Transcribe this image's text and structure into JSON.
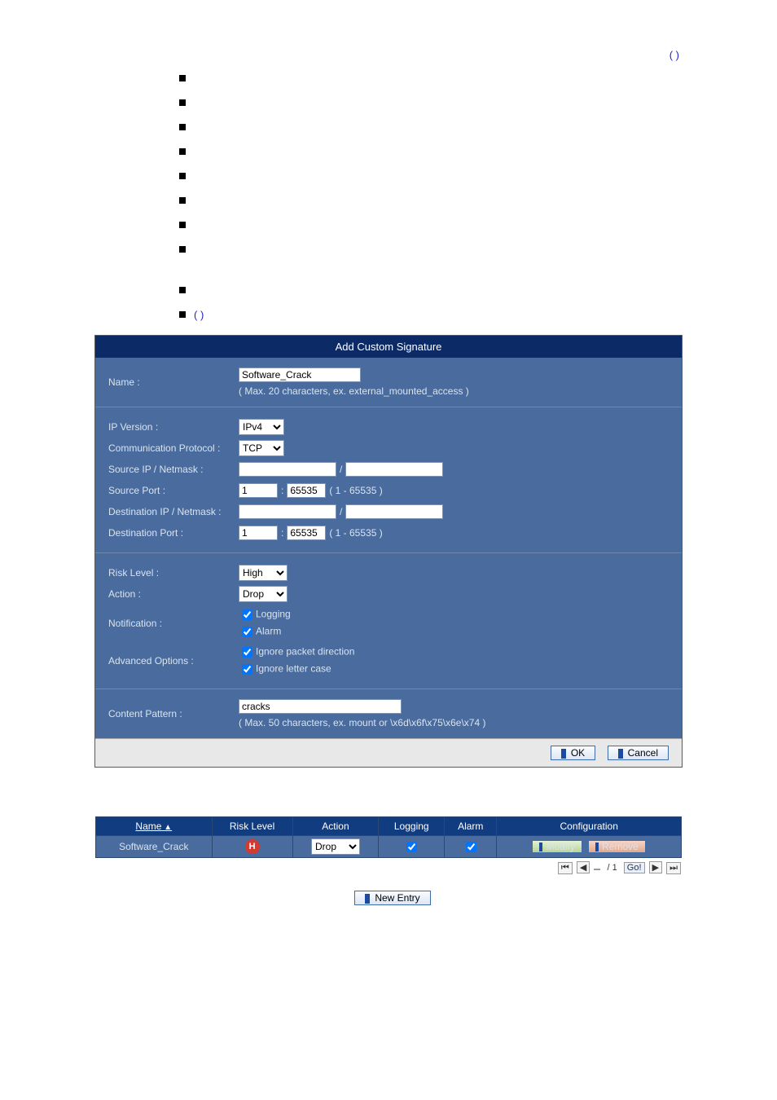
{
  "header": {
    "paren": "(          )",
    "listParen": "(             )"
  },
  "form": {
    "title": "Add Custom Signature",
    "labels": {
      "name": "Name :",
      "ipversion": "IP Version :",
      "protocol": "Communication Protocol :",
      "srcip": "Source IP / Netmask :",
      "srcport": "Source Port :",
      "dstip": "Destination IP / Netmask :",
      "dstport": "Destination Port :",
      "risk": "Risk Level :",
      "action": "Action :",
      "notification": "Notification :",
      "advanced": "Advanced Options :",
      "content": "Content Pattern :"
    },
    "values": {
      "name": "Software_Crack",
      "ipversion": "IPv4",
      "protocol": "TCP",
      "srcPortFrom": "1",
      "srcPortTo": "65535",
      "dstPortFrom": "1",
      "dstPortTo": "65535",
      "risk": "High",
      "action": "Drop",
      "content": "cracks"
    },
    "hints": {
      "name": "( Max. 20 characters, ex. external_mounted_access )",
      "port": "( 1 - 65535 )",
      "content": "( Max. 50 characters, ex. mount or \\x6d\\x6f\\x75\\x6e\\x74 )"
    },
    "checks": {
      "logging": "Logging",
      "alarm": "Alarm",
      "ignoreDir": "Ignore packet direction",
      "ignoreCase": "Ignore letter case"
    },
    "buttons": {
      "ok": "OK",
      "cancel": "Cancel"
    }
  },
  "table": {
    "headers": {
      "name": "Name",
      "risk": "Risk Level",
      "action": "Action",
      "logging": "Logging",
      "alarm": "Alarm",
      "config": "Configuration"
    },
    "rows": [
      {
        "name": "Software_Crack",
        "riskGlyph": "H",
        "action": "Drop",
        "modify": "Modify",
        "remove": "Remove"
      }
    ],
    "pager": {
      "current": "",
      "sep": "/ 1",
      "go": "Go!"
    },
    "newEntry": "New Entry"
  }
}
